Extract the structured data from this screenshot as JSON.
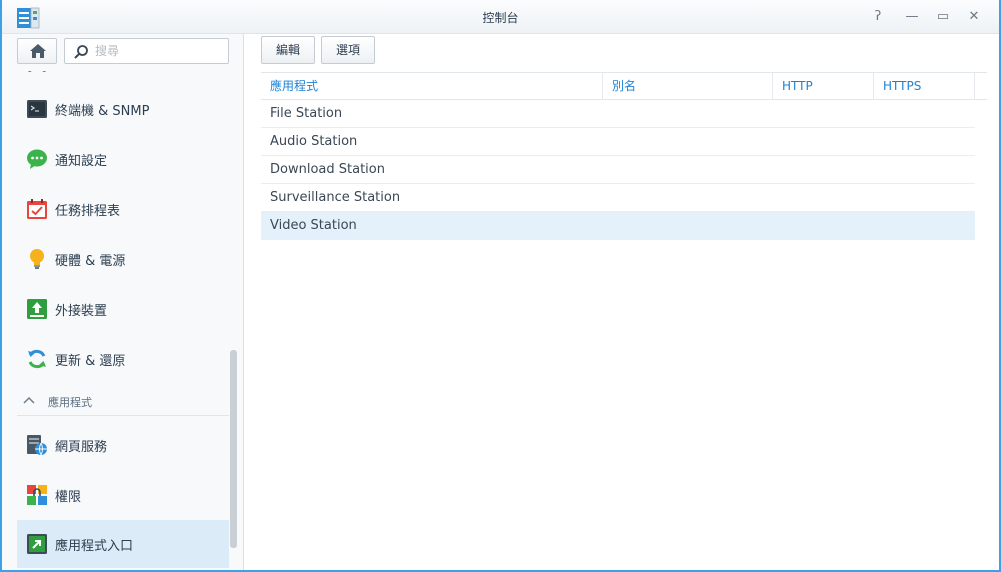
{
  "window": {
    "title": "控制台",
    "controls": {
      "help": "ʔ",
      "minimize": "—",
      "maximize": "▭",
      "close": "✕"
    }
  },
  "sidebar": {
    "search": {
      "placeholder": "搜尋",
      "value": ""
    },
    "items": [
      {
        "label": "終端機 & SNMP",
        "icon": "terminal-icon"
      },
      {
        "label": "通知設定",
        "icon": "notification-icon"
      },
      {
        "label": "任務排程表",
        "icon": "task-scheduler-icon"
      },
      {
        "label": "硬體 & 電源",
        "icon": "lightbulb-icon"
      },
      {
        "label": "外接裝置",
        "icon": "external-device-icon"
      },
      {
        "label": "更新 & 還原",
        "icon": "update-restore-icon"
      }
    ],
    "section": {
      "label": "應用程式",
      "expanded": true
    },
    "section_items": [
      {
        "label": "網頁服務",
        "icon": "web-services-icon"
      },
      {
        "label": "權限",
        "icon": "privileges-icon"
      },
      {
        "label": "應用程式入口",
        "icon": "application-portal-icon",
        "active": true
      }
    ]
  },
  "toolbar": {
    "edit_label": "編輯",
    "options_label": "選項"
  },
  "table": {
    "columns": [
      "應用程式",
      "別名",
      "HTTP",
      "HTTPS"
    ],
    "rows": [
      {
        "application": "File Station",
        "alias": "",
        "http": "",
        "https": ""
      },
      {
        "application": "Audio Station",
        "alias": "",
        "http": "",
        "https": ""
      },
      {
        "application": "Download Station",
        "alias": "",
        "http": "",
        "https": ""
      },
      {
        "application": "Surveillance Station",
        "alias": "",
        "http": "",
        "https": ""
      },
      {
        "application": "Video Station",
        "alias": "",
        "http": "",
        "https": "",
        "selected": true
      }
    ]
  },
  "colors": {
    "accent": "#1f82d4",
    "selected_row": "#e4f1fb",
    "active_nav": "#dcebf8"
  }
}
